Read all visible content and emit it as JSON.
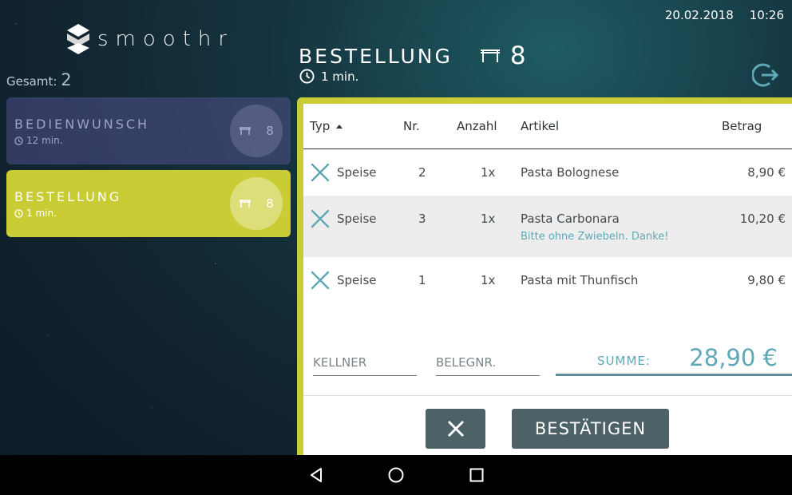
{
  "status": {
    "date": "20.02.2018",
    "time": "10:26"
  },
  "app": {
    "logo_text": "smoothr"
  },
  "sidebar": {
    "total_label": "Gesamt:",
    "total_count": "2",
    "cards": [
      {
        "title": "BEDIENWUNSCH",
        "time": "12 min.",
        "table": "8"
      },
      {
        "title": "BESTELLUNG",
        "time": "1 min.",
        "table": "8"
      }
    ]
  },
  "header": {
    "title": "BESTELLUNG",
    "table": "8",
    "time": "1 min."
  },
  "table": {
    "columns": [
      "Typ",
      "Nr.",
      "Anzahl",
      "Artikel",
      "Betrag"
    ],
    "rows": [
      {
        "typ": "Speise",
        "nr": "2",
        "anzahl": "1x",
        "artikel": "Pasta Bolognese",
        "betrag": "8,90 €",
        "note": ""
      },
      {
        "typ": "Speise",
        "nr": "3",
        "anzahl": "1x",
        "artikel": "Pasta Carbonara",
        "betrag": "10,20 €",
        "note": "Bitte ohne Zwiebeln. Danke!"
      },
      {
        "typ": "Speise",
        "nr": "1",
        "anzahl": "1x",
        "artikel": "Pasta mit Thunfisch",
        "betrag": "9,80 €",
        "note": ""
      }
    ]
  },
  "footer": {
    "kellner_placeholder": "KELLNER",
    "belegnr_placeholder": "BELEGNR.",
    "summe_label": "SUMME:",
    "summe_value": "28,90 €",
    "confirm_label": "BESTÄTIGEN"
  },
  "colors": {
    "accent": "#c9cc34",
    "teal": "#5fa8b6",
    "button": "#4d6266"
  }
}
